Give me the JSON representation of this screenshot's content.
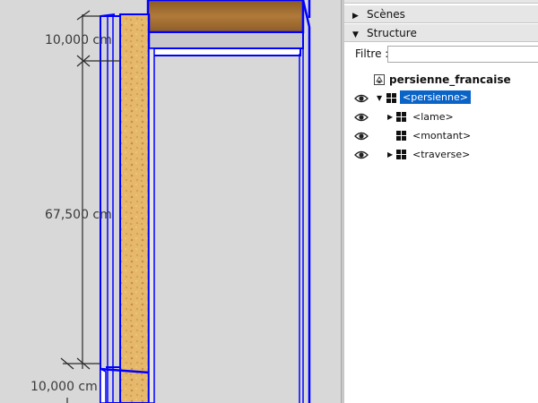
{
  "dimensions": {
    "top": "10,000 cm",
    "middle": "67,500 cm",
    "bottom": "10,000 cm"
  },
  "panel": {
    "sections": [
      {
        "label": "Scènes",
        "expanded": false
      },
      {
        "label": "Structure",
        "expanded": true
      }
    ],
    "filter": {
      "label": "Filtre :",
      "value": ""
    },
    "tree": {
      "root": "persienne_francaise",
      "items": [
        {
          "label": "<persienne>",
          "selected": true,
          "expander": "expanded",
          "visible": true
        },
        {
          "label": "<lame>",
          "selected": false,
          "expander": "collapsed",
          "visible": true
        },
        {
          "label": "<montant>",
          "selected": false,
          "expander": "none",
          "visible": true
        },
        {
          "label": "<traverse>",
          "selected": false,
          "expander": "collapsed",
          "visible": true
        }
      ]
    }
  },
  "colors": {
    "selection": "#0a64c8",
    "edge_highlight": "#0000ff",
    "wood": "#e3b468",
    "plank": "#9b6b30"
  },
  "icons": {
    "eye": "eye-icon",
    "component": "component-icon",
    "model": "model-icon",
    "expand": "triangle-right-icon",
    "collapse": "triangle-down-icon"
  }
}
